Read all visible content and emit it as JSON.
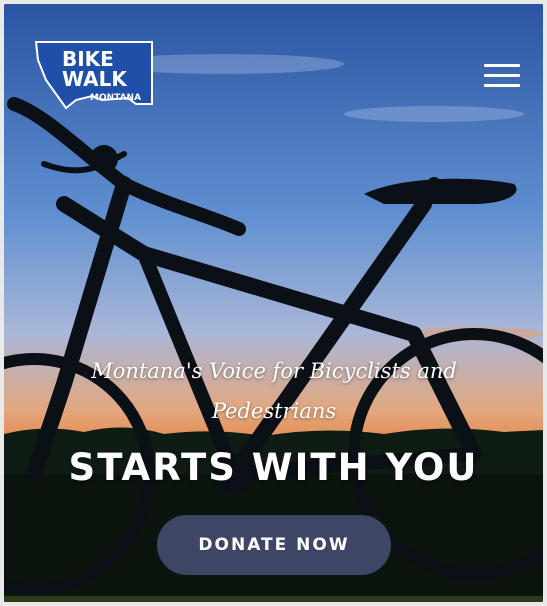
{
  "header": {
    "logo": {
      "line1": "BIKE",
      "line2": "WALK",
      "line3": "MONTANA",
      "icon": "montana-state-logo-icon"
    },
    "menu_icon": "hamburger-menu-icon"
  },
  "hero": {
    "tagline_line1": "Montana's Voice for Bicyclists and",
    "tagline_line2": "Pedestrians",
    "headline": "STARTS WITH YOU",
    "cta_label": "DONATE NOW"
  },
  "colors": {
    "logo_blue": "#1f4fa8",
    "button_bg": "#3d4665",
    "sky_top": "#2f5fb0",
    "sunset": "#e8894a"
  }
}
